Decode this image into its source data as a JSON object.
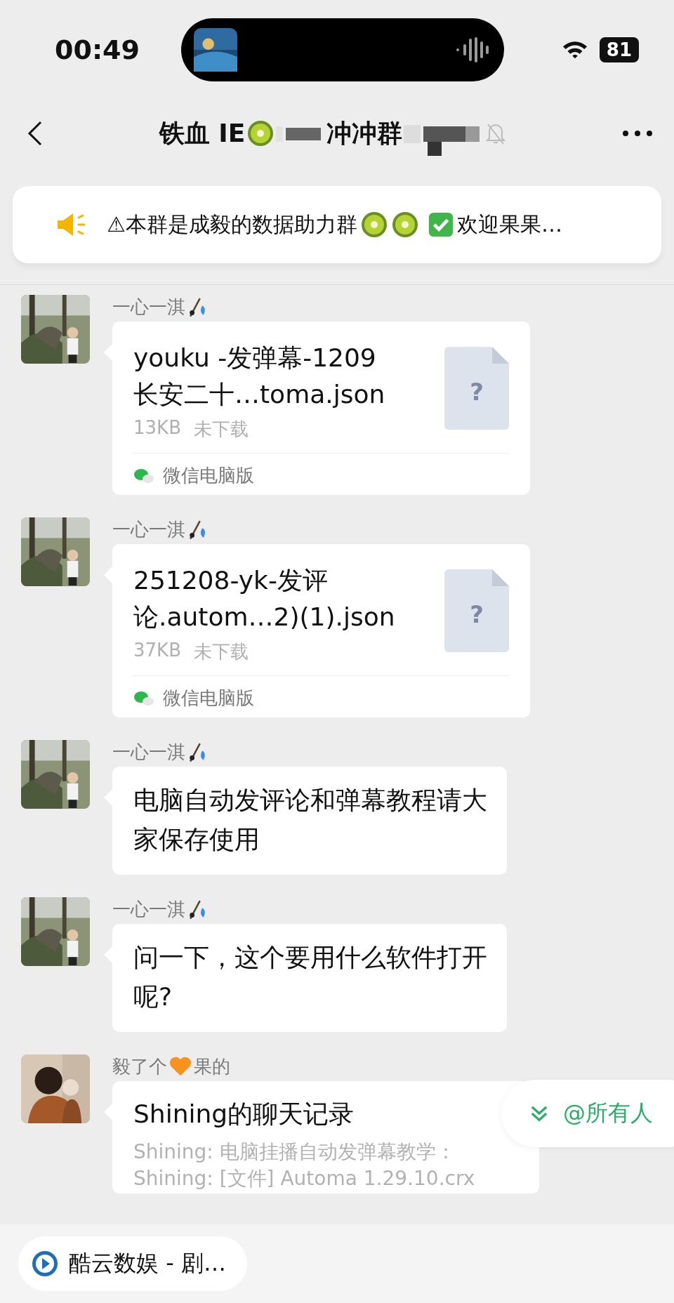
{
  "status_bar": {
    "time": "00:49",
    "battery": "81"
  },
  "header": {
    "title_start": "铁血 IE",
    "title_middle": "冲冲群"
  },
  "announcement": {
    "text_start": "⚠本群是成毅的数据助力群",
    "text_end": "欢迎果果…"
  },
  "messages": [
    {
      "kind": "file",
      "sender": "一心一淇",
      "title_lines": [
        "youku -发弹幕-1209",
        "长安二十…toma.json"
      ],
      "size": "13KB",
      "status": "未下载",
      "icon_glyph": "?",
      "source": "微信电脑版"
    },
    {
      "kind": "file",
      "sender": "一心一淇",
      "title_lines": [
        "251208-yk-发评",
        "论.autom…2)(1).json"
      ],
      "size": "37KB",
      "status": "未下载",
      "icon_glyph": "?",
      "source": "微信电脑版"
    },
    {
      "kind": "text",
      "sender": "一心一淇",
      "lines": [
        "电脑自动发评论和弹幕教程请大",
        "家保存使用"
      ]
    },
    {
      "kind": "text",
      "sender": "一心一淇",
      "lines": [
        "问一下，这个要用什么软件打开",
        "呢?"
      ]
    },
    {
      "kind": "record",
      "sender_start": "毅了个",
      "sender_end": "果的",
      "title": "Shining的聊天记录",
      "lines": [
        "Shining: 电脑挂播自动发弹幕教学：",
        "Shining: [文件] Automa 1.29.10.crx"
      ]
    }
  ],
  "mention_button": "@所有人",
  "mini_program": {
    "label": "酷云数娱 - 剧…"
  }
}
